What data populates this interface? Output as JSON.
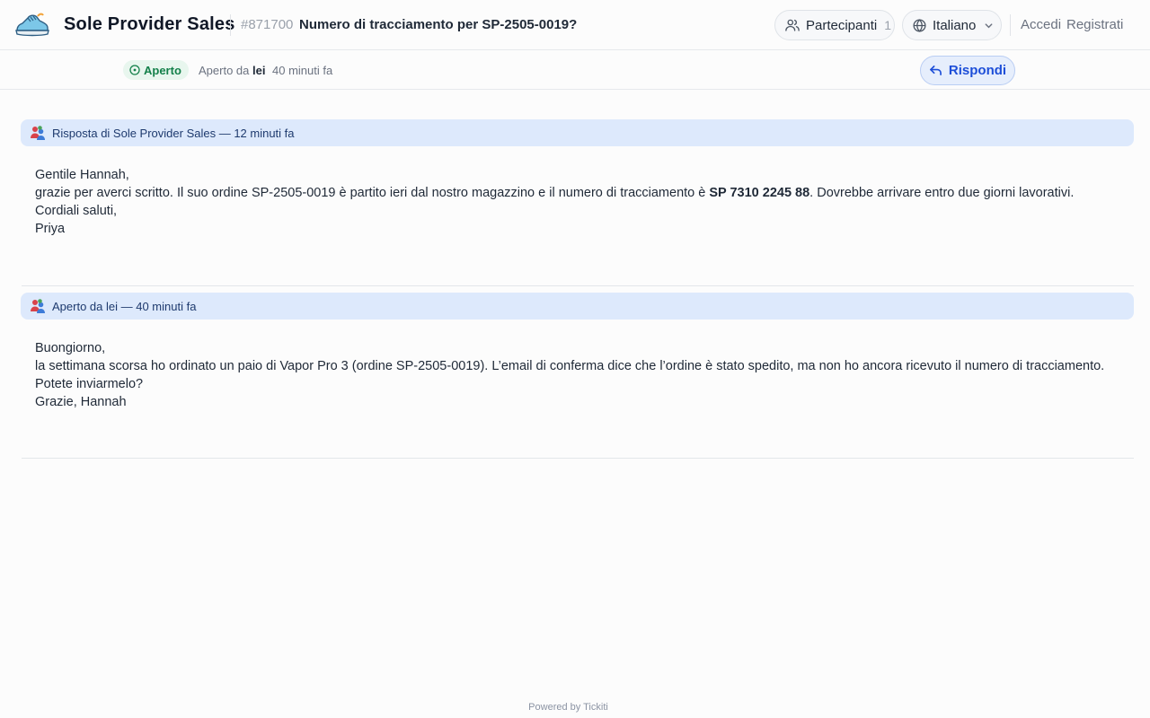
{
  "header": {
    "brand": "Sole Provider Sales",
    "ticket_id": "#871700",
    "ticket_title": "Numero di tracciamento per SP-2505-0019?",
    "participants_label": "Partecipanti",
    "participants_count": "1",
    "language": "Italiano",
    "login": "Accedi",
    "register": "Registrati"
  },
  "subbar": {
    "status": "Aperto",
    "status_color": "#14804a",
    "opened_by_prefix": "Aperto da",
    "opened_by_user": "lei",
    "opened_time": "40 minuti fa",
    "reply_label": "Rispondi"
  },
  "messages": [
    {
      "header": "Risposta di Sole Provider Sales — 12 minuti fa",
      "greeting": "Gentile Hannah,",
      "line_prefix": "grazie per averci scritto. Il suo ordine SP-2505-0019 è partito ieri dal nostro magazzino e il numero di tracciamento è ",
      "tracking": "SP 7310 2245 88",
      "line_suffix": ". Dovrebbe arrivare entro due giorni lavorativi.",
      "closing": "Cordiali saluti,",
      "signature": "Priya"
    },
    {
      "header": "Aperto da lei — 40 minuti fa",
      "greeting": "Buongiorno,",
      "line": "la settimana scorsa ho ordinato un paio di Vapor Pro 3 (ordine SP-2505-0019). L’email di conferma dice che l’ordine è stato spedito, ma non ho ancora ricevuto il numero di tracciamento.",
      "question": "Potete inviarmelo?",
      "signature": "Grazie, Hannah"
    }
  ],
  "footer": "Powered by Tickiti",
  "colors": {
    "accent": "#1d4ed8",
    "message_header_bg": "#dde9fc",
    "status_bg": "#e8f6ee"
  },
  "icons": [
    "sneaker-logo-icon",
    "participants-icon",
    "globe-icon",
    "chevron-down-icon",
    "open-status-icon",
    "reply-arrow-icon",
    "users-icon"
  ]
}
